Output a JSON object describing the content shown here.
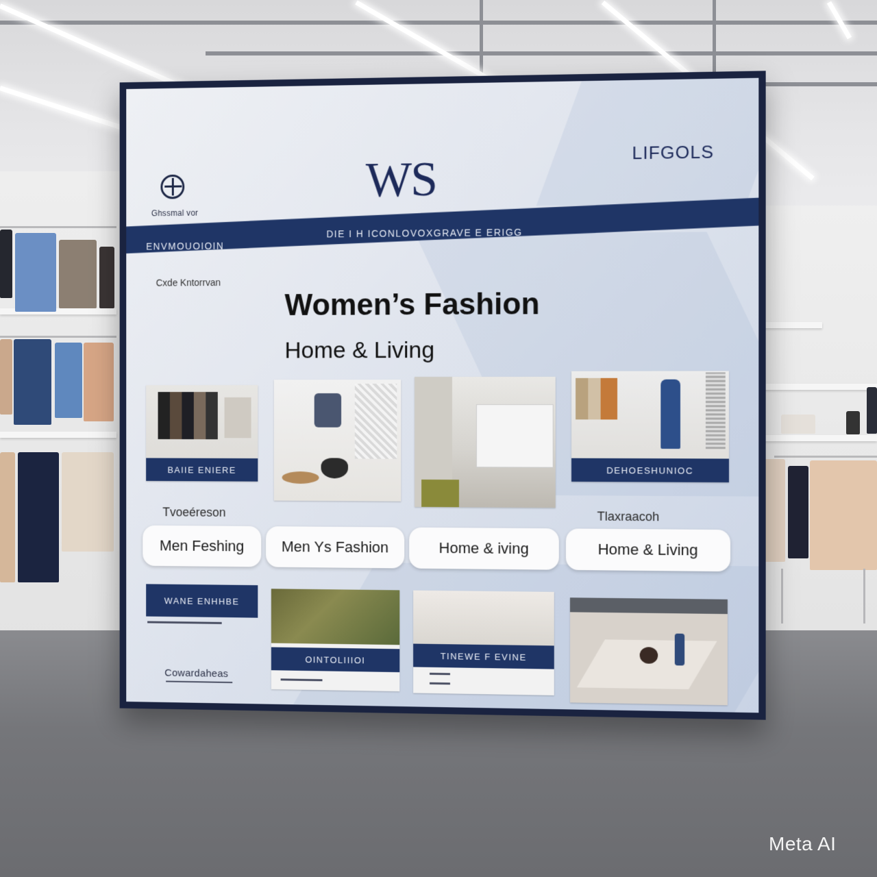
{
  "board": {
    "logo_caption": "Ghssmal vor",
    "brand": "WS",
    "top_right": "LIFGOLS",
    "nav_left": "ENVMOUOIOIN",
    "nav_center": "DIE I H ICONLOVOXGRAVE E ERIGG",
    "side_caption": "Cxde Kntorrvan",
    "hero_title": "Women’s Fashion",
    "hero_subtitle": "Home & Living",
    "tiles_row1": [
      {
        "label": "BAIIE ENIERE"
      },
      {
        "label": ""
      },
      {
        "label": ""
      },
      {
        "label": "DEHOESHUNIOC"
      }
    ],
    "caption_left": "Tvoeéreson",
    "caption_right": "Tlaxraacoh",
    "pills": [
      "Men Feshing",
      "Men Ys Fashion",
      "Home & iving",
      "Home & Living"
    ],
    "tiles_row2": [
      {
        "label": "WANE ENHHBE"
      },
      {
        "label": "OINTOLIIIOI"
      },
      {
        "label": "TINEWE F EVINE"
      },
      {
        "label": ""
      }
    ],
    "footer_caption": "Cowardaheas"
  },
  "watermark": "Meta AI",
  "colors": {
    "navy": "#1f3566",
    "frame": "#1a2340",
    "board_light": "#eef0f4"
  }
}
